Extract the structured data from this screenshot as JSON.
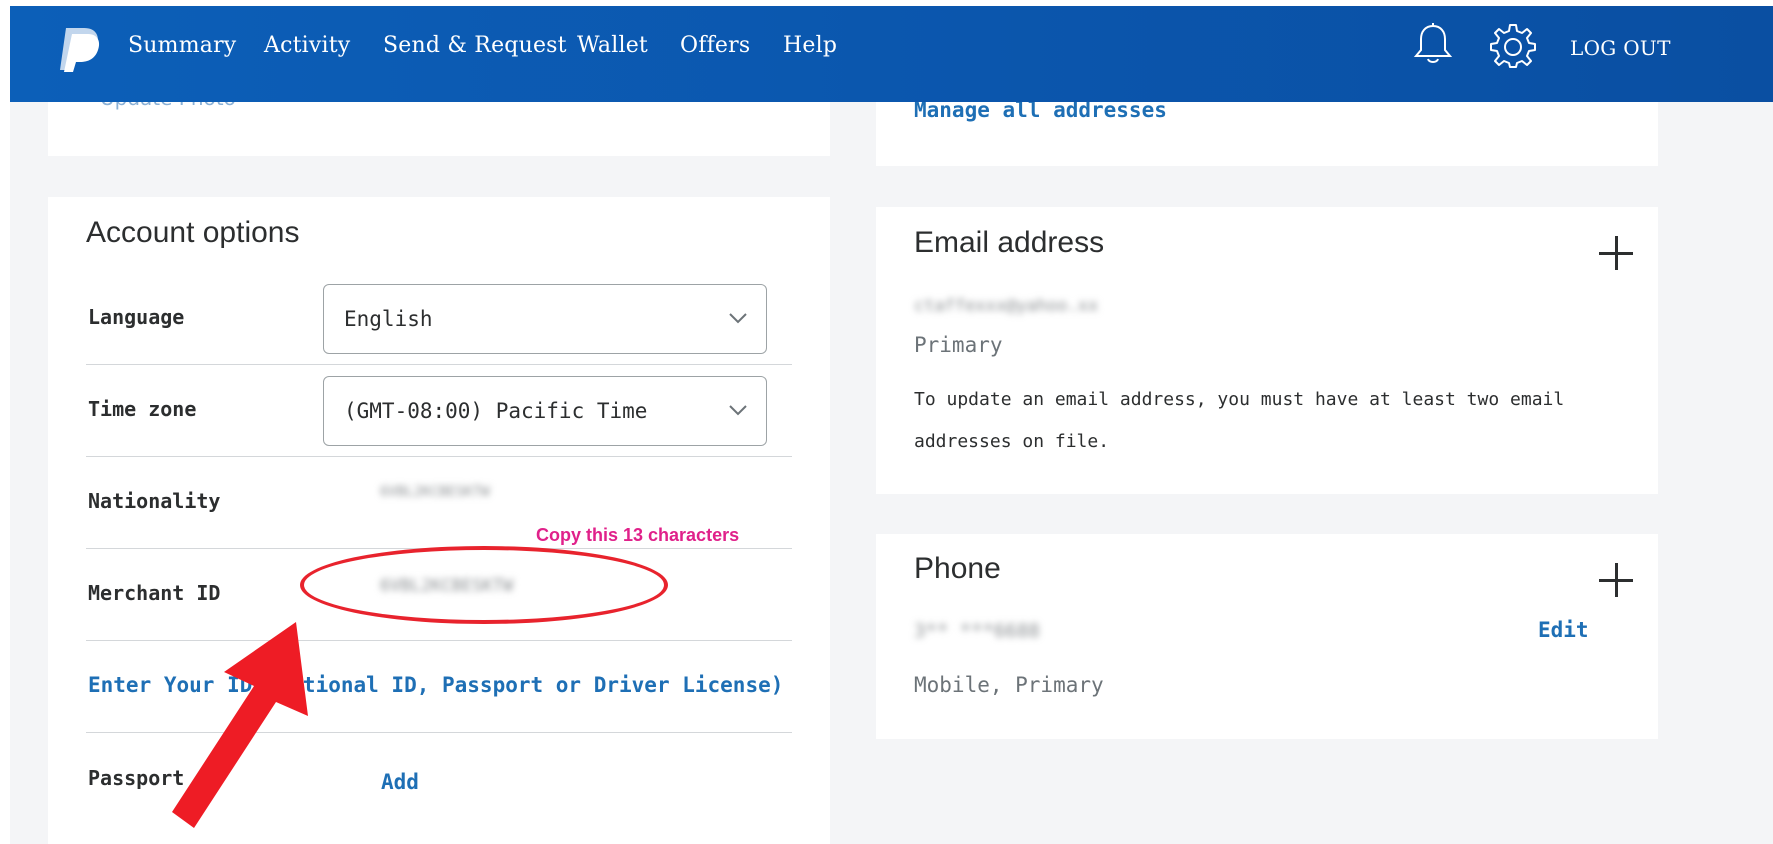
{
  "header": {
    "nav": [
      "Summary",
      "Activity",
      "Send & Request",
      "Wallet",
      "Offers",
      "Help"
    ],
    "logout": "LOG OUT"
  },
  "profile": {
    "update_photo": "Update Photo",
    "manage_addresses": "Manage all addresses"
  },
  "account_options": {
    "title": "Account options",
    "language_label": "Language",
    "language_value": "English",
    "timezone_label": "Time zone",
    "timezone_value": "(GMT-08:00) Pacific Time",
    "nationality_label": "Nationality",
    "nationality_value": "6VBL2KCBESKTW",
    "merchant_label": "Merchant ID",
    "merchant_value": "6VBL2KCBESKTW",
    "id_link": "Enter Your ID (National ID, Passport or Driver License)",
    "passport_label": "Passport",
    "passport_add": "Add"
  },
  "annotation": {
    "text": "Copy this 13 characters"
  },
  "email": {
    "title": "Email address",
    "value": "ctaffexxx@yahoo.xx",
    "type": "Primary",
    "note": "To update an email address, you must have at least two email addresses on file."
  },
  "phone": {
    "title": "Phone",
    "value": "3** ***6688",
    "edit": "Edit",
    "type": "Mobile, Primary"
  },
  "colors": {
    "header": "#0c5fb8",
    "link": "#1e6fb5",
    "annotation_text": "#e0218a",
    "annotation_red": "#e8232d"
  }
}
